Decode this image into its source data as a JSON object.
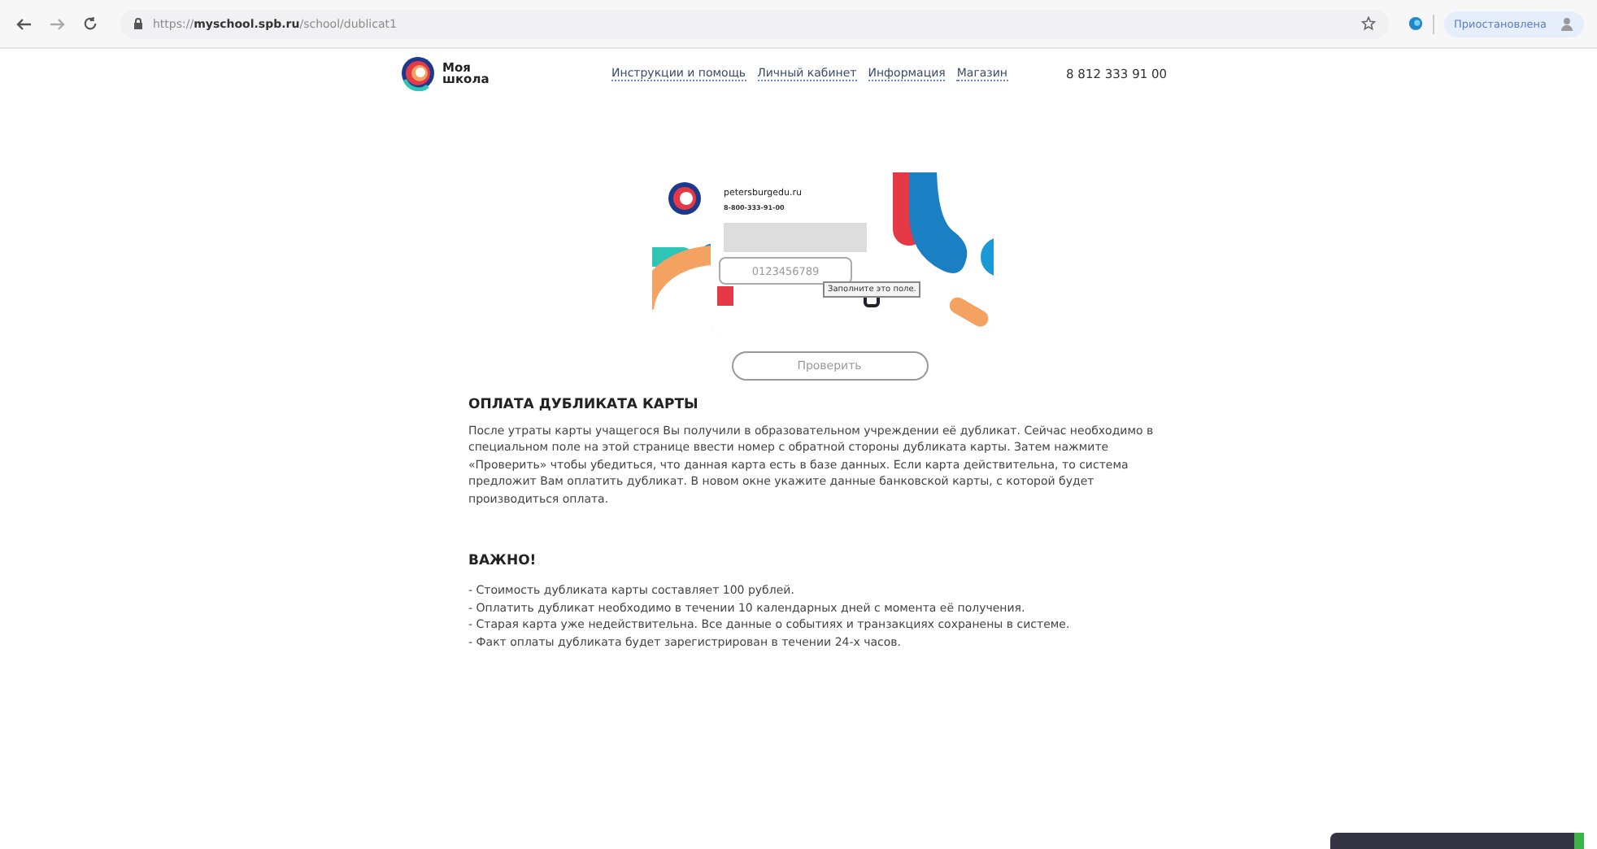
{
  "browser": {
    "url": "https://**myschool.spb.ru**/school/dublicat1",
    "profile": "Приостановлена"
  },
  "header": {
    "logo": "Моя\nшкола",
    "nav": [
      "Инструкции и помощь",
      "Личный кабинет",
      "Информация",
      "Магазин"
    ],
    "phone": "8 812 333 91 00"
  },
  "card": {
    "site": "petersburgedu.ru",
    "phone": "8-800-333-91-00",
    "input_value": "0123456789",
    "tooltip": "Заполните это поле."
  },
  "check_button": "Проверить",
  "title": "ОПЛАТА ДУБЛИКАТА КАРТЫ",
  "description": "После утраты карты учащегося Вы получили в образовательном учреждении её дубликат. Сейчас необходимо в специальном поле на этой странице ввести номер с обратной стороны дубликата карты. Затем нажмите «Проверить» чтобы убедиться, что данная карта есть в базе данных. Если карта действительна, то система предложит Вам оплатить дубликат. В новом окне укажите данные банковской карты, с которой будет производиться оплата.",
  "important": {
    "title": "ВАЖНО!",
    "items": [
      "- Стоимость дубликата карты составляет 100 рублей.",
      "- Оплатить дубликат необходимо в течении 10 календарных дней с момента её получения.",
      "- Старая карта уже недействительна. Все данные о событиях и транзакциях сохранены в системе.",
      "- Факт оплаты дубликата будет зарегистрирован в течении 24-х часов."
    ]
  }
}
